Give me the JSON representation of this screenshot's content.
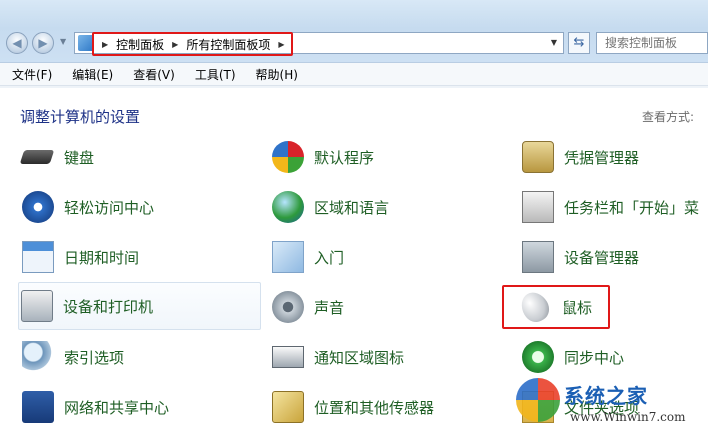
{
  "address_bar": {
    "breadcrumbs": [
      "控制面板",
      "所有控制面板项"
    ]
  },
  "search": {
    "placeholder": "搜索控制面板"
  },
  "menu": [
    "文件(F)",
    "编辑(E)",
    "查看(V)",
    "工具(T)",
    "帮助(H)"
  ],
  "header": {
    "title": "调整计算机的设置",
    "view_by": "查看方式:"
  },
  "items": [
    {
      "label": "键盘",
      "icon": "keyboard-icon"
    },
    {
      "label": "默认程序",
      "icon": "default-programs-icon"
    },
    {
      "label": "凭据管理器",
      "icon": "credential-manager-icon"
    },
    {
      "label": "轻松访问中心",
      "icon": "ease-of-access-icon"
    },
    {
      "label": "区域和语言",
      "icon": "globe-icon"
    },
    {
      "label": "任务栏和「开始」菜",
      "icon": "taskbar-icon"
    },
    {
      "label": "日期和时间",
      "icon": "calendar-icon"
    },
    {
      "label": "入门",
      "icon": "getting-started-icon"
    },
    {
      "label": "设备管理器",
      "icon": "device-manager-icon"
    },
    {
      "label": "设备和打印机",
      "icon": "printer-icon"
    },
    {
      "label": "声音",
      "icon": "speaker-icon"
    },
    {
      "label": "鼠标",
      "icon": "mouse-icon"
    },
    {
      "label": "索引选项",
      "icon": "indexing-icon"
    },
    {
      "label": "通知区域图标",
      "icon": "notification-tray-icon"
    },
    {
      "label": "同步中心",
      "icon": "sync-center-icon"
    },
    {
      "label": "网络和共享中心",
      "icon": "network-icon"
    },
    {
      "label": "位置和其他传感器",
      "icon": "location-sensor-icon"
    },
    {
      "label": "文件夹选项",
      "icon": "folder-options-icon"
    }
  ],
  "watermark": {
    "brand": "系统之家",
    "url": "www.Winwin7.com"
  }
}
